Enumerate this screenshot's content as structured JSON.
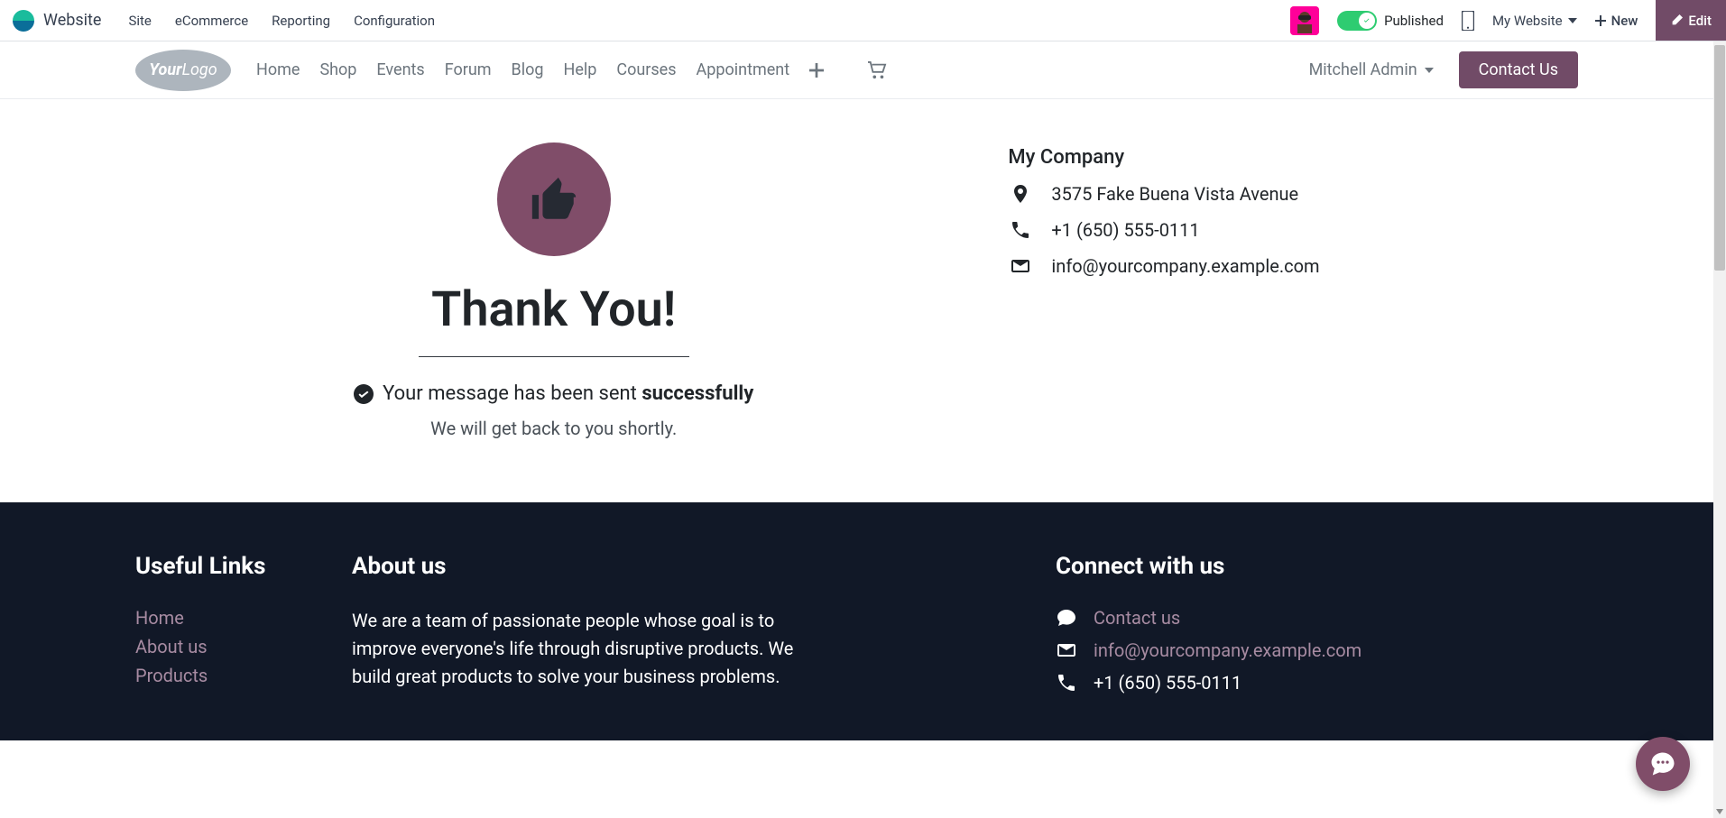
{
  "admin": {
    "app_name": "Website",
    "menu": [
      "Site",
      "eCommerce",
      "Reporting",
      "Configuration"
    ],
    "published_label": "Published",
    "my_website_label": "My Website",
    "new_label": "New",
    "edit_label": "Edit"
  },
  "nav": {
    "links": [
      "Home",
      "Shop",
      "Events",
      "Forum",
      "Blog",
      "Help",
      "Courses",
      "Appointment"
    ],
    "user": "Mitchell Admin",
    "contact_label": "Contact Us"
  },
  "main": {
    "heading": "Thank You!",
    "sent_prefix": "Your message has been sent ",
    "sent_strong": "successfully",
    "shortly": "We will get back to you shortly.",
    "company": {
      "name": "My Company",
      "address": "3575 Fake Buena Vista Avenue",
      "phone": "+1 (650) 555-0111",
      "email": "info@yourcompany.example.com"
    }
  },
  "footer": {
    "useful_title": "Useful Links",
    "useful_links": [
      "Home",
      "About us",
      "Products"
    ],
    "about_title": "About us",
    "about_text": "We are a team of passionate people whose goal is to improve everyone's life through disruptive products. We build great products to solve your business problems.",
    "connect_title": "Connect with us",
    "contact_us": "Contact us",
    "email": "info@yourcompany.example.com",
    "phone": "+1 (650) 555-0111"
  }
}
